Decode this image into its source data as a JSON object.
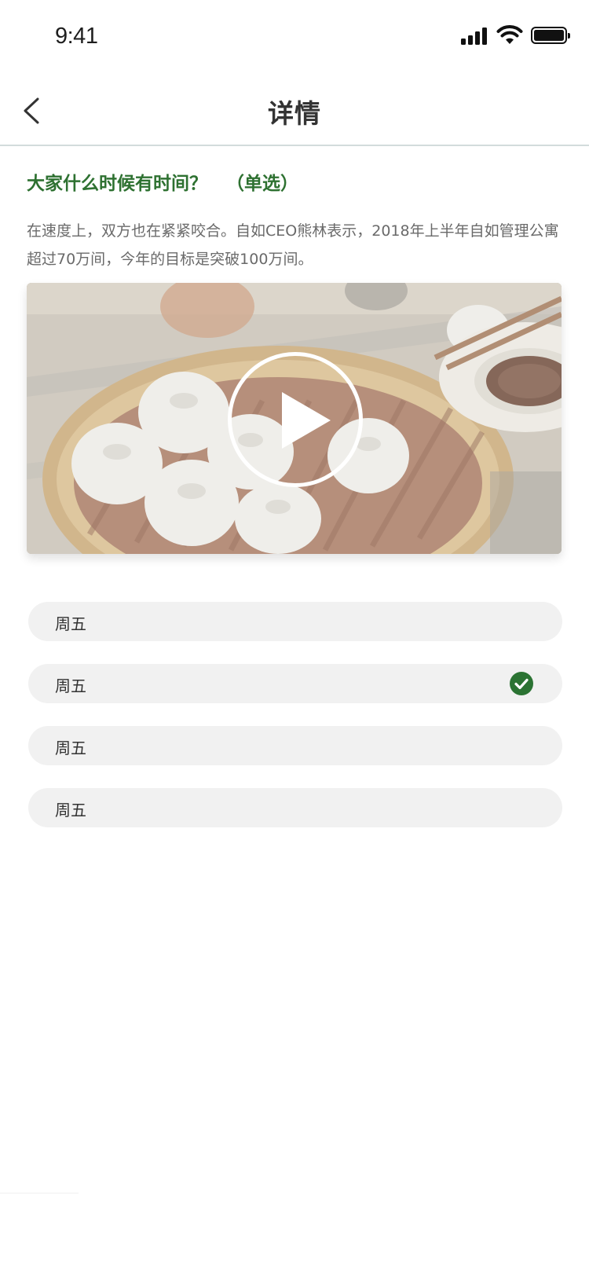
{
  "status_bar": {
    "time": "9:41"
  },
  "nav": {
    "title": "详情"
  },
  "question": {
    "title": "大家什么时候有时间？",
    "type": "（单选）",
    "description": "在速度上，双方也在紧紧咬合。自如CEO熊林表示，2018年上半年自如管理公寓超过70万间，今年的目标是突破100万间。"
  },
  "video": {
    "thumbnail_subject": "steamed dumplings in bamboo steamer"
  },
  "options": [
    {
      "label": "周五",
      "selected": false
    },
    {
      "label": "周五",
      "selected": true
    },
    {
      "label": "周五",
      "selected": false
    },
    {
      "label": "周五",
      "selected": false
    }
  ],
  "colors": {
    "accent": "#2e7131",
    "check": "#2b7333",
    "option_bg": "#f1f1f1",
    "divider": "#d3dcdc"
  }
}
